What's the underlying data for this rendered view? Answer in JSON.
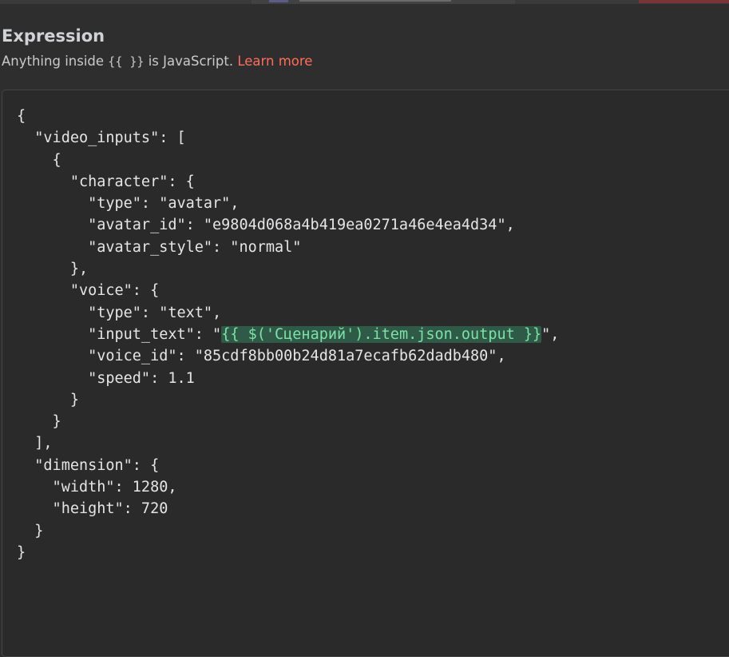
{
  "header": {
    "title": "Expression",
    "subtitle_before": "Anything inside ",
    "subtitle_code": "{{ }}",
    "subtitle_after": " is JavaScript. ",
    "learn_more": "Learn more"
  },
  "colors": {
    "accent": "#ff6d5a",
    "background": "#2e2e2e",
    "editor_background": "#2a2a2a",
    "expression_highlight_bg": "#2e5a47",
    "expression_highlight_text": "#7ce3a6"
  },
  "editor": {
    "lines": [
      [
        "{"
      ],
      [
        "  \"video_inputs\": ["
      ],
      [
        "    {"
      ],
      [
        "      \"character\": {"
      ],
      [
        "        \"type\": \"avatar\","
      ],
      [
        "        \"avatar_id\": \"e9804d068a4b419ea0271a46e4ea4d34\","
      ],
      [
        "        \"avatar_style\": \"normal\""
      ],
      [
        "      },"
      ],
      [
        "      \"voice\": {"
      ],
      [
        "        \"type\": \"text\","
      ],
      [
        "        \"input_text\": \"",
        "{{ $('Сценарий').item.json.output }}",
        "\","
      ],
      [
        "        \"voice_id\": \"85cdf8bb00b24d81a7ecafb62dadb480\","
      ],
      [
        "        \"speed\": 1.1"
      ],
      [
        "      }"
      ],
      [
        "    }"
      ],
      [
        "  ],"
      ],
      [
        "  \"dimension\": {"
      ],
      [
        "    \"width\": 1280,"
      ],
      [
        "    \"height\": 720"
      ],
      [
        "  }"
      ],
      [
        "}"
      ]
    ]
  }
}
